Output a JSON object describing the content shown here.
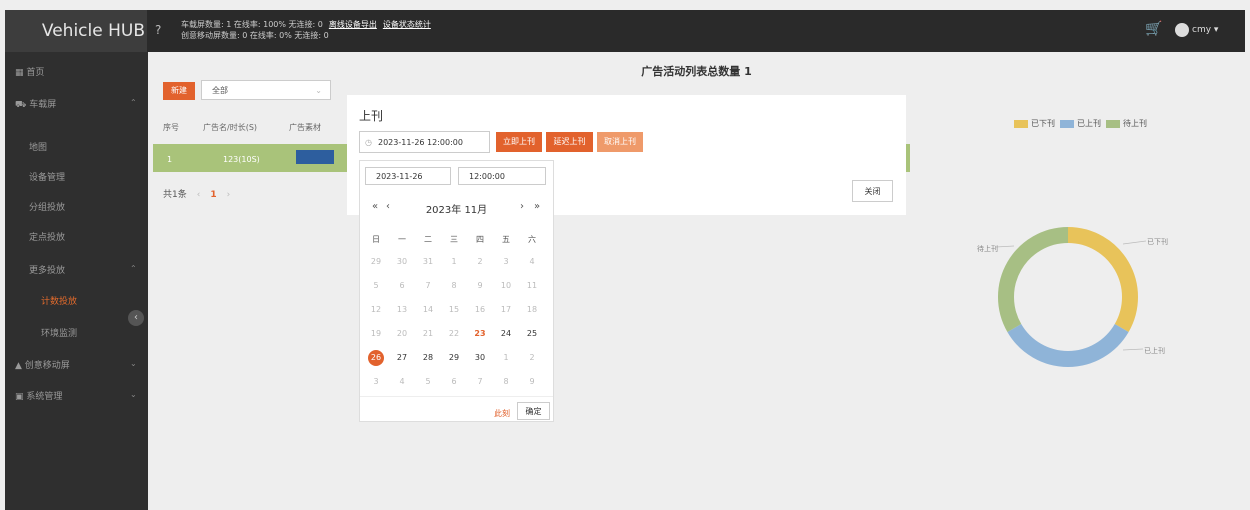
{
  "header": {
    "brand": "Vehicle HUB",
    "help_icon": "help-circle-icon",
    "stats_line1": "车载屏数量: 1  在线率: 100%  无连接: 0",
    "link_export": "离线设备导出",
    "link_status": "设备状态统计",
    "stats_line2": "创意移动屏数量: 0  在线率: 0%  无连接: 0",
    "cart_icon": "cart-icon",
    "user": "cmy ▾"
  },
  "sidebar": {
    "items": [
      {
        "label": "首页"
      },
      {
        "label": "车载屏"
      },
      {
        "label": "地图"
      },
      {
        "label": "设备管理"
      },
      {
        "label": "分组投放"
      },
      {
        "label": "定点投放"
      },
      {
        "label": "更多投放"
      },
      {
        "label": "计数投放"
      },
      {
        "label": "环境监测"
      },
      {
        "label": "创意移动屏"
      },
      {
        "label": "系统管理"
      }
    ],
    "collapse_glyph": "‹"
  },
  "main": {
    "title": "广告活动列表总数量 1",
    "new_button": "新建",
    "filter_value": "全部",
    "table": {
      "headers": [
        "序号",
        "广告名/时长(S)",
        "广告素材"
      ],
      "row": {
        "index": "1",
        "name": "123(10S)"
      }
    },
    "pager": {
      "total": "共1条",
      "prev": "‹",
      "page": "1",
      "next": "›"
    }
  },
  "chart_data": {
    "type": "pie",
    "variant": "donut",
    "categories": [
      "已下刊",
      "已上刊",
      "待上刊"
    ],
    "values": [
      1,
      1,
      1
    ],
    "colors": [
      "#e8c35a",
      "#8fb4d8",
      "#a7bf84"
    ],
    "legend": "top-right"
  },
  "modal": {
    "title": "上刊",
    "datetime_value": "2023-11-26 12:00:00",
    "btn_now": "立即上刊",
    "btn_delay": "延迟上刊",
    "btn_cancel": "取消上刊",
    "btn_close": "关闭"
  },
  "picker": {
    "date_value": "2023-11-26",
    "time_value": "12:00:00",
    "nav_prev_year": "«",
    "nav_prev_month": "‹",
    "month_label": "2023年 11月",
    "nav_next_month": "›",
    "nav_next_year": "»",
    "weekdays": [
      "日",
      "一",
      "二",
      "三",
      "四",
      "五",
      "六"
    ],
    "days": [
      [
        "29",
        "30",
        "31",
        "1",
        "2",
        "3",
        "4"
      ],
      [
        "5",
        "6",
        "7",
        "8",
        "9",
        "10",
        "11"
      ],
      [
        "12",
        "13",
        "14",
        "15",
        "16",
        "17",
        "18"
      ],
      [
        "19",
        "20",
        "21",
        "22",
        "23",
        "24",
        "25"
      ],
      [
        "26",
        "27",
        "28",
        "29",
        "30",
        "1",
        "2"
      ],
      [
        "3",
        "4",
        "5",
        "6",
        "7",
        "8",
        "9"
      ]
    ],
    "now_label": "此刻",
    "ok_label": "确定"
  }
}
